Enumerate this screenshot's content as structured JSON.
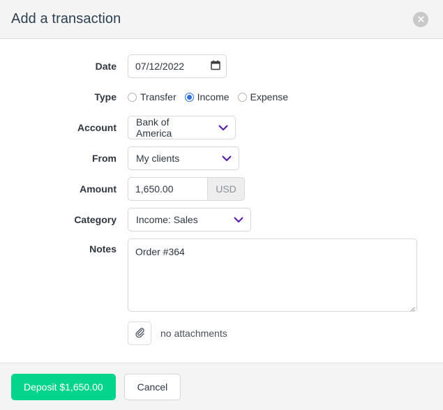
{
  "dialog": {
    "title": "Add a transaction",
    "close_icon": "close-icon"
  },
  "form": {
    "date": {
      "label": "Date",
      "value": "07/12/2022",
      "icon": "calendar-icon"
    },
    "type": {
      "label": "Type",
      "selected": "Income",
      "options": [
        {
          "label": "Transfer",
          "selected": false
        },
        {
          "label": "Income",
          "selected": true
        },
        {
          "label": "Expense",
          "selected": false
        }
      ]
    },
    "account": {
      "label": "Account",
      "value": "Bank of America",
      "icon": "chevron-down-icon"
    },
    "from": {
      "label": "From",
      "value": "My clients",
      "icon": "chevron-down-icon"
    },
    "amount": {
      "label": "Amount",
      "value": "1,650.00",
      "currency": "USD"
    },
    "category": {
      "label": "Category",
      "value": "Income: Sales",
      "icon": "chevron-down-icon"
    },
    "notes": {
      "label": "Notes",
      "value": "Order #364"
    },
    "attachments": {
      "icon": "paperclip-icon",
      "text": "no attachments"
    }
  },
  "footer": {
    "submit_label": "Deposit $1,650.00",
    "cancel_label": "Cancel"
  },
  "colors": {
    "primary": "#05d48c",
    "radio_selected": "#2f6fd8",
    "chevron": "#5b1fa8",
    "header_bg": "#f4f4f4",
    "title": "#2c3e50"
  }
}
